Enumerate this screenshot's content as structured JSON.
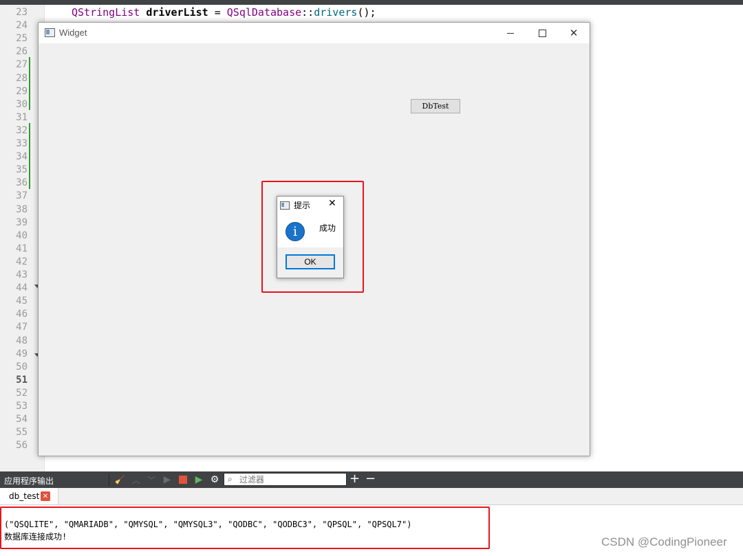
{
  "editor": {
    "line_numbers": [
      "23",
      "24",
      "25",
      "26",
      "27",
      "28",
      "29",
      "30",
      "31",
      "32",
      "33",
      "34",
      "35",
      "36",
      "37",
      "38",
      "39",
      "40",
      "41",
      "42",
      "43",
      "44",
      "45",
      "46",
      "47",
      "48",
      "49",
      "50",
      "51",
      "52",
      "53",
      "54",
      "55",
      "56"
    ],
    "current_line": "51",
    "code_type": "QStringList",
    "code_var": "driverList",
    "code_class": "QSqlDatabase",
    "code_fn": "drivers"
  },
  "widget": {
    "title": "Widget",
    "button_label": "DbTest"
  },
  "message_box": {
    "title": "提示",
    "text": "成功",
    "ok_label": "OK"
  },
  "output": {
    "pane_title": "应用程序输出",
    "filter_placeholder": "过滤器",
    "tab_label": "db_test",
    "lines": [
      "(\"QSQLITE\", \"QMARIADB\", \"QMYSQL\", \"QMYSQL3\", \"QODBC\", \"QODBC3\", \"QPSQL\", \"QPSQL7\")",
      "数据库连接成功!"
    ]
  },
  "watermark": "CSDN @CodingPioneer",
  "colors": {
    "highlight_border": "#e8131b",
    "info_icon": "#1a73c8",
    "ok_focus": "#0078d7",
    "output_toolbar": "#404244"
  },
  "icons": [
    "window-app-icon",
    "minimize-icon",
    "maximize-icon",
    "close-icon",
    "info-icon",
    "clear-icon",
    "up-arrow-icon",
    "down-arrow-icon",
    "run-icon",
    "stop-icon",
    "debug-run-icon",
    "settings-icon",
    "search-icon",
    "plus-icon",
    "minus-icon"
  ]
}
